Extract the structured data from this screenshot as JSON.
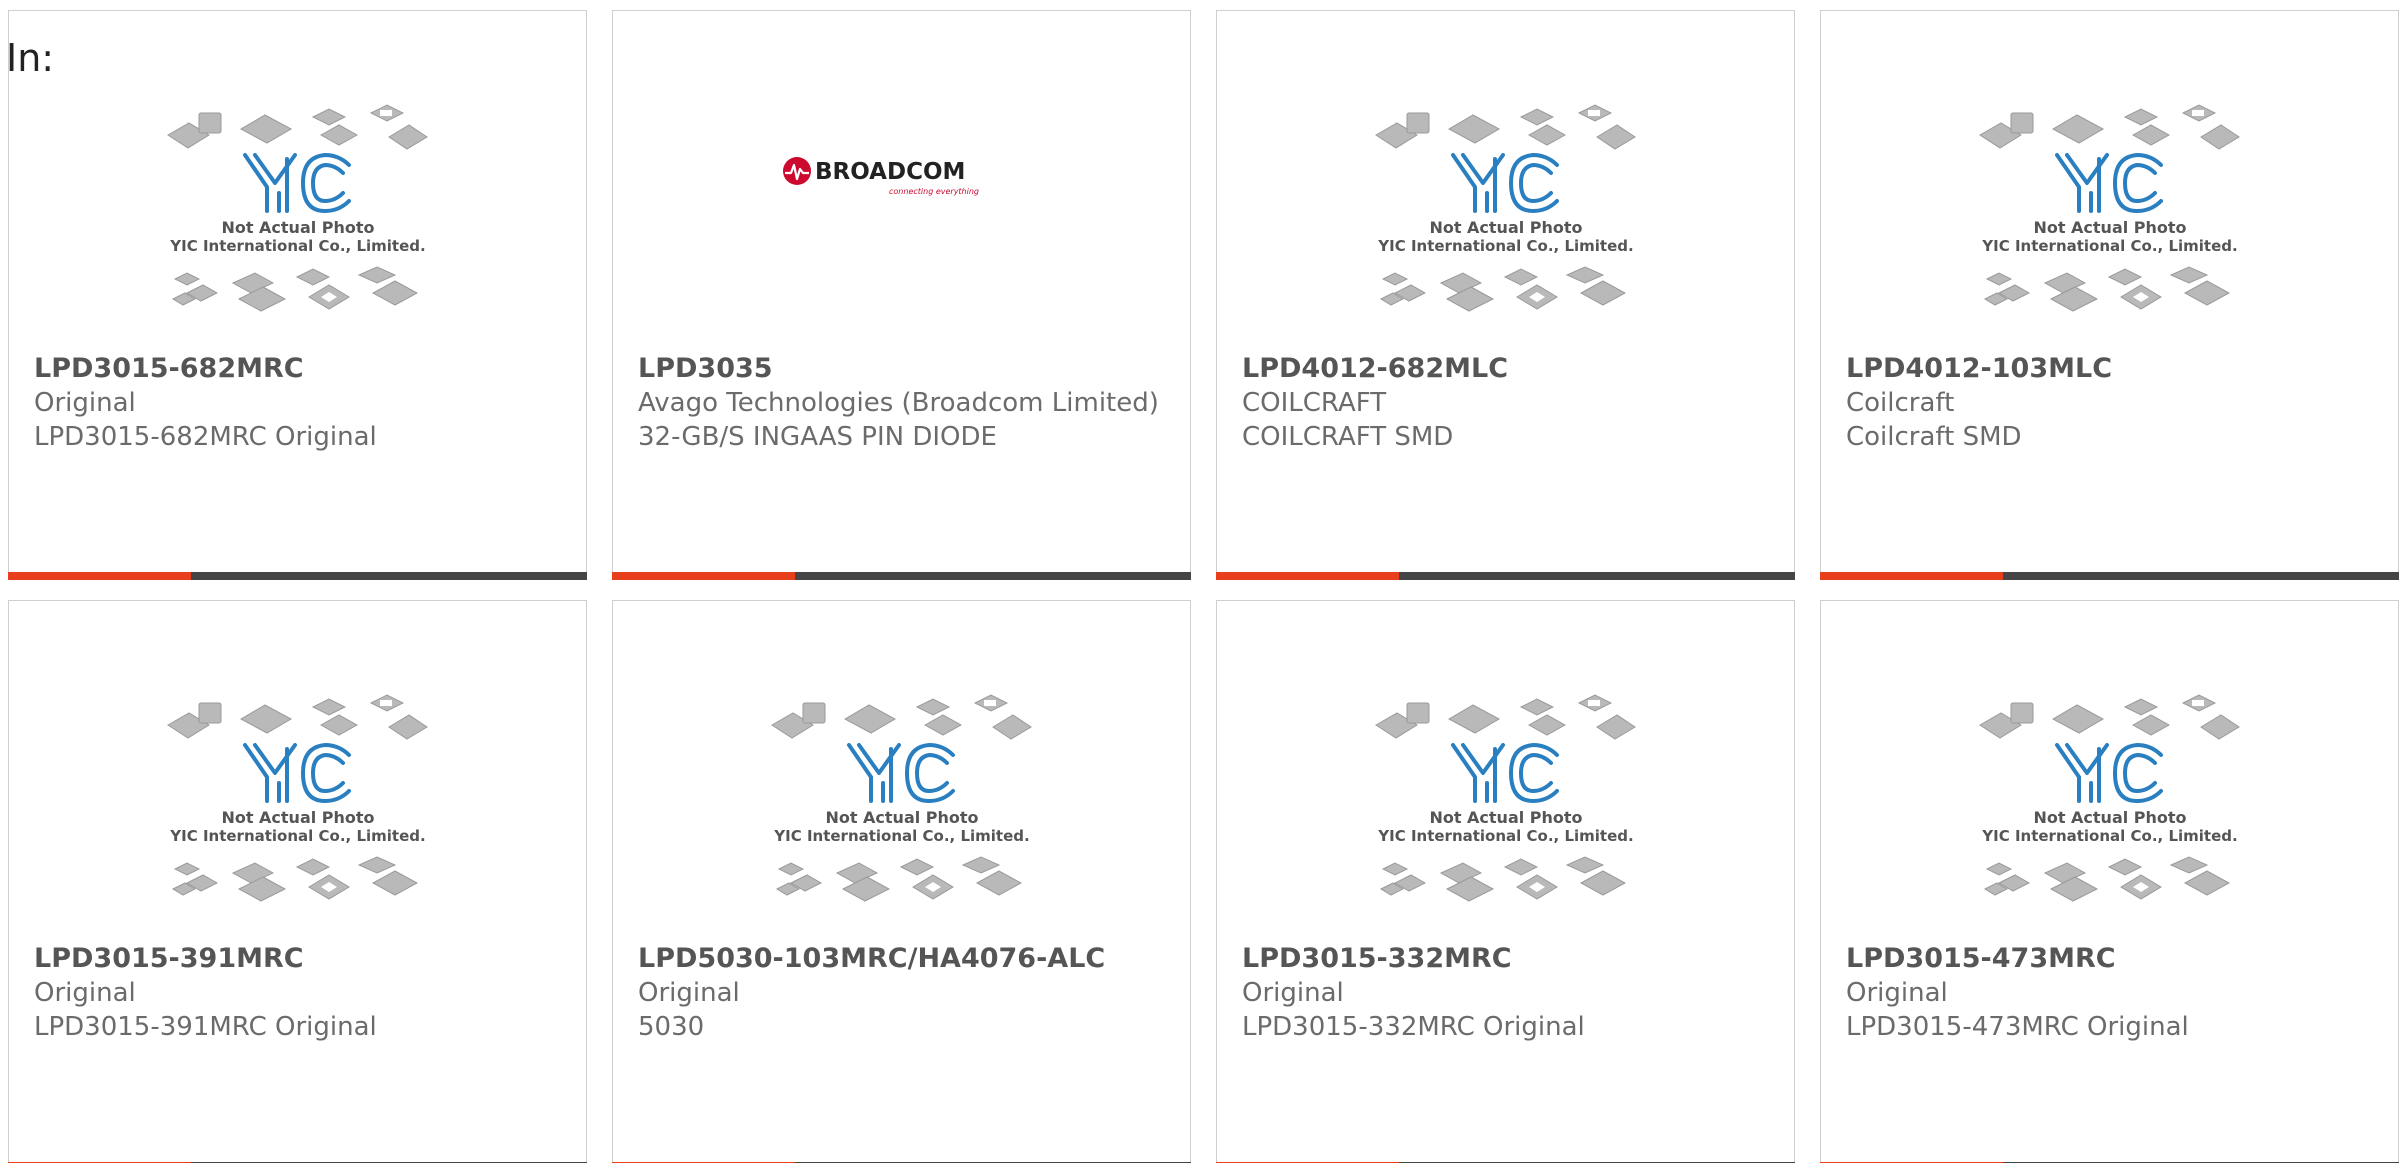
{
  "filter_label": "In:",
  "placeholder_caption": {
    "line1": "Not Actual Photo",
    "line2": "YIC International Co., Limited."
  },
  "broadcom_logo": {
    "name": "BROADCOM",
    "tagline": "connecting everything"
  },
  "products": [
    {
      "part": "LPD3015-682MRC",
      "manufacturer": "Original",
      "description": "LPD3015-682MRC Original",
      "image": "yic-placeholder"
    },
    {
      "part": "LPD3035",
      "manufacturer": "Avago Technologies (Broadcom Limited)",
      "description": "32-GB/S INGAAS PIN DIODE",
      "image": "broadcom-logo"
    },
    {
      "part": "LPD4012-682MLC",
      "manufacturer": "COILCRAFT",
      "description": "COILCRAFT SMD",
      "image": "yic-placeholder"
    },
    {
      "part": "LPD4012-103MLC",
      "manufacturer": "Coilcraft",
      "description": "Coilcraft SMD",
      "image": "yic-placeholder"
    },
    {
      "part": "LPD3015-391MRC",
      "manufacturer": "Original",
      "description": "LPD3015-391MRC Original",
      "image": "yic-placeholder"
    },
    {
      "part": "LPD5030-103MRC/HA4076-ALC",
      "manufacturer": "Original",
      "description": "5030",
      "image": "yic-placeholder"
    },
    {
      "part": "LPD3015-332MRC",
      "manufacturer": "Original",
      "description": "LPD3015-332MRC Original",
      "image": "yic-placeholder"
    },
    {
      "part": "LPD3015-473MRC",
      "manufacturer": "Original",
      "description": "LPD3015-473MRC Original",
      "image": "yic-placeholder"
    }
  ],
  "colors": {
    "accent": "#e8401c",
    "bar": "#454545",
    "yic_blue": "#2a7fc1",
    "text": "#6b6b6b"
  }
}
